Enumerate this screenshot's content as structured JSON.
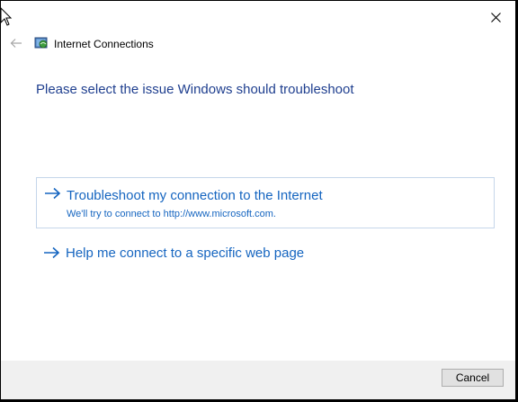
{
  "window": {
    "title": "Internet Connections",
    "close_icon": "close-icon",
    "back_icon": "back-arrow-icon",
    "app_icon": "internet-connections-icon"
  },
  "main": {
    "heading": "Please select the issue Windows should troubleshoot",
    "options": [
      {
        "title": "Troubleshoot my connection to the Internet",
        "description": "We'll try to connect to http://www.microsoft.com.",
        "icon": "arrow-right-icon",
        "selected": true
      },
      {
        "title": "Help me connect to a specific web page",
        "icon": "arrow-right-icon",
        "selected": false
      }
    ]
  },
  "footer": {
    "cancel_label": "Cancel"
  },
  "colors": {
    "heading": "#1f3f8f",
    "link": "#1565c0",
    "selected_border": "#c5d6ea",
    "footer_bg": "#f0f0f0"
  }
}
